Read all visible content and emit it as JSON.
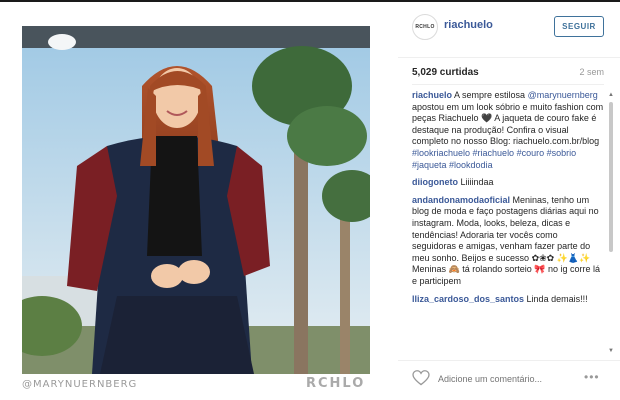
{
  "post": {
    "watermark_left": "@MARYNUERNBERG",
    "watermark_right": "RCHLO"
  },
  "header": {
    "avatar_text": "RCHLO",
    "username": "riachuelo",
    "follow_label": "SEGUIR"
  },
  "stats": {
    "likes": "5,029 curtidas",
    "age": "2 sem"
  },
  "caption": {
    "user": "riachuelo",
    "text_1": " A sempre estilosa ",
    "mention": "@marynuernberg",
    "text_2": " apostou em um look sóbrio e muito fashion com peças Riachuelo 🖤 A jaqueta de couro fake é destaque na produção! Confira o visual completo no nosso Blog: riachuelo.com.br/blog ",
    "hashtags": "#lookriachuelo #riachuelo #couro #sobrio #jaqueta #lookdodia"
  },
  "comments": [
    {
      "user": "diiogoneto",
      "text": " Liiiindaa"
    },
    {
      "user": "andandonamodaoficial",
      "text": " Meninas, tenho um blog de moda e faço postagens diárias aqui no instagram. Moda, looks, beleza, dicas e tendências! Adoraria ter vocês como seguidoras e amigas, venham fazer parte do meu sonho. Beijos e sucesso ✿❀✿ ✨👗✨ Meninas 🙈 tá rolando sorteio 🎀 no ig corre lá e participem"
    },
    {
      "user": "lliza_cardoso_dos_santos",
      "text": " Linda demais!!!"
    }
  ],
  "footer": {
    "comment_placeholder": "Adicione um comentário...",
    "more_label": "•••"
  },
  "icons": {
    "like": "heart-icon",
    "more": "more-options-icon"
  }
}
